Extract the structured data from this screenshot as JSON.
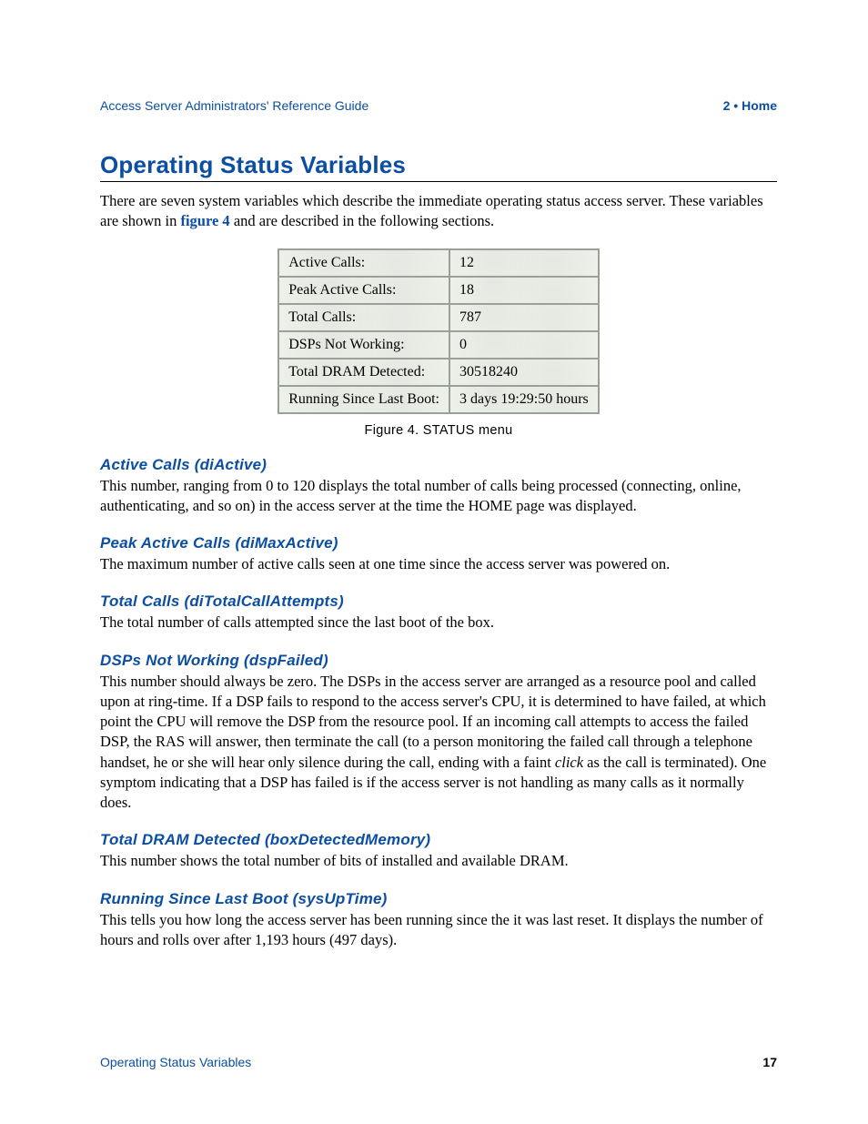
{
  "header": {
    "left": "Access Server Administrators' Reference Guide",
    "right": "2 • Home"
  },
  "section_title": "Operating Status Variables",
  "intro_before_ref": " There are seven system variables which describe the immediate operating status access server. These variables are shown in ",
  "intro_ref": "figure 4",
  "intro_after_ref": " and are described in the following sections.",
  "status_table": {
    "rows": [
      {
        "label": "Active Calls:",
        "value": "12"
      },
      {
        "label": "Peak Active Calls:",
        "value": "18"
      },
      {
        "label": "Total Calls:",
        "value": "787"
      },
      {
        "label": "DSPs Not Working:",
        "value": "0"
      },
      {
        "label": "Total DRAM Detected:",
        "value": "30518240"
      },
      {
        "label": "Running Since Last Boot:",
        "value": "3 days 19:29:50 hours"
      }
    ]
  },
  "figure_caption": "Figure 4. STATUS menu",
  "subsections": {
    "active_calls": {
      "heading": "Active Calls (diActive)",
      "body": "This number, ranging from 0 to 120 displays the total number of calls being processed (connecting, online, authenticating, and so on) in the access server at the time the HOME page was displayed."
    },
    "peak_active_calls": {
      "heading": "Peak Active Calls (diMaxActive)",
      "body": "The maximum number of active calls seen at one time since the access server was powered on."
    },
    "total_calls": {
      "heading": "Total Calls (diTotalCallAttempts)",
      "body": "The total number of calls attempted since the last boot of the box."
    },
    "dsps_not_working": {
      "heading": "DSPs Not Working (dspFailed)",
      "body_before_em": "This number should always be zero. The DSPs in the access server are arranged as a resource pool and called upon at ring-time. If a DSP fails to respond to the access server's CPU, it is determined to have failed, at which point the CPU will remove the DSP from the resource pool. If an incoming call attempts to access the failed DSP, the RAS will answer, then terminate the call (to a person monitoring the failed call through a telephone handset, he or she will hear only silence during the call, ending with a faint ",
      "body_em": "click",
      "body_after_em": " as the call is terminated). One symptom indicating that a DSP has failed is if the access server is not handling as many calls as it normally does."
    },
    "total_dram": {
      "heading": "Total DRAM Detected (boxDetectedMemory)",
      "body": "This number shows the total number of bits of installed and available DRAM."
    },
    "running_since": {
      "heading": "Running Since Last Boot (sysUpTime)",
      "body": "This tells you how long the access server has been running since the it was last reset. It displays the number of hours and rolls over after 1,193 hours (497 days)."
    }
  },
  "footer": {
    "left": "Operating Status Variables",
    "right": "17"
  }
}
